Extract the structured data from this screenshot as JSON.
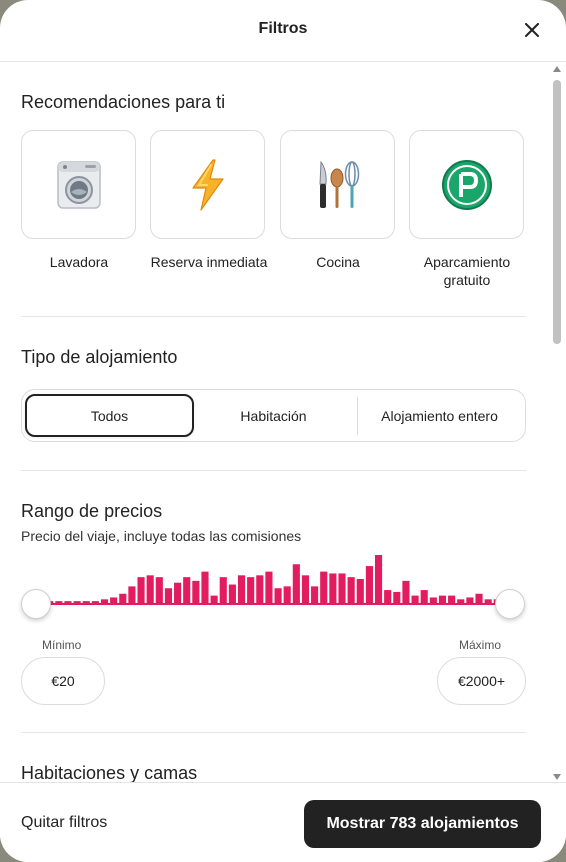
{
  "header": {
    "title": "Filtros",
    "close_icon": "close-icon"
  },
  "recommendations": {
    "title": "Recomendaciones para ti",
    "items": [
      {
        "label": "Lavadora",
        "icon": "washing-machine-icon"
      },
      {
        "label": "Reserva inmediata",
        "icon": "lightning-icon"
      },
      {
        "label": "Cocina",
        "icon": "kitchen-utensils-icon"
      },
      {
        "label": "Aparcamiento gratuito",
        "icon": "parking-icon"
      }
    ]
  },
  "lodging_type": {
    "title": "Tipo de alojamiento",
    "options": [
      "Todos",
      "Habitación",
      "Alojamiento entero"
    ],
    "selected": "Todos"
  },
  "price_range": {
    "title": "Rango de precios",
    "subtitle": "Precio del viaje, incluye todas las comisiones",
    "min_label": "Mínimo",
    "max_label": "Máximo",
    "min_value": "€20",
    "max_value": "€2000+",
    "accent": "#e31c5f",
    "histogram": [
      1,
      1,
      1,
      1,
      1,
      1,
      1,
      2,
      3,
      5,
      9,
      14,
      15,
      14,
      8,
      11,
      14,
      12,
      17,
      4,
      14,
      10,
      15,
      14,
      15,
      17,
      8,
      9,
      21,
      15,
      9,
      17,
      16,
      16,
      14,
      13,
      20,
      26,
      7,
      6,
      12,
      4,
      7,
      3,
      4,
      4,
      2,
      3,
      5,
      2,
      2,
      1
    ]
  },
  "rooms_beds": {
    "title": "Habitaciones y camas"
  },
  "footer": {
    "clear_label": "Quitar filtros",
    "show_label": "Mostrar 783 alojamientos"
  }
}
